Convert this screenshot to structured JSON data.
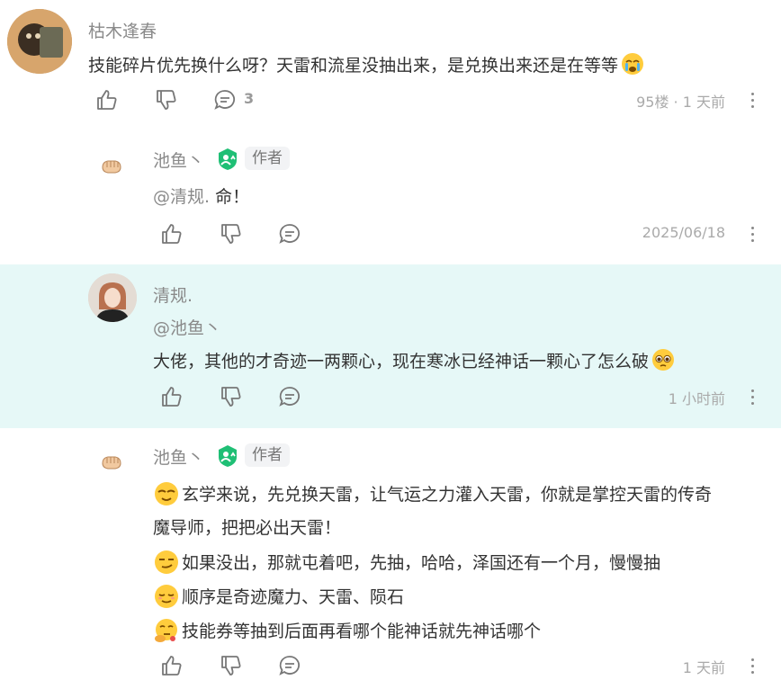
{
  "comments": [
    {
      "user": "枯木逢春",
      "text": "技能碎片优先换什么呀？天雷和流星没抽出来，是兑换出来还是在等等",
      "reply_count": "3",
      "meta": "95楼 · 1 天前"
    },
    {
      "user": "池鱼丶",
      "badge": "作者",
      "mention": "@清规.",
      "text": " 命！",
      "meta": "2025/06/18"
    },
    {
      "user": "清规.",
      "mention": "@池鱼丶",
      "text": "大佬，其他的才奇迹一两颗心，现在寒冰已经神话一颗心了怎么破",
      "meta": "1 小时前"
    },
    {
      "user": "池鱼丶",
      "badge": "作者",
      "lines": [
        "玄学来说，先兑换天雷，让气运之力灌入天雷，你就是掌控天雷的传奇",
        "魔导师，把把必出天雷！",
        "如果没出，那就屯着吧，先抽，哈哈，泽国还有一个月，慢慢抽",
        "顺序是奇迹魔力、天雷、陨石",
        "技能券等抽到后面再看哪个能神话就先神话哪个"
      ],
      "meta": "1 天前"
    }
  ],
  "colors": {
    "highlight_bg": "#e6f8f7",
    "author_badge_green": "#1fbf75"
  }
}
